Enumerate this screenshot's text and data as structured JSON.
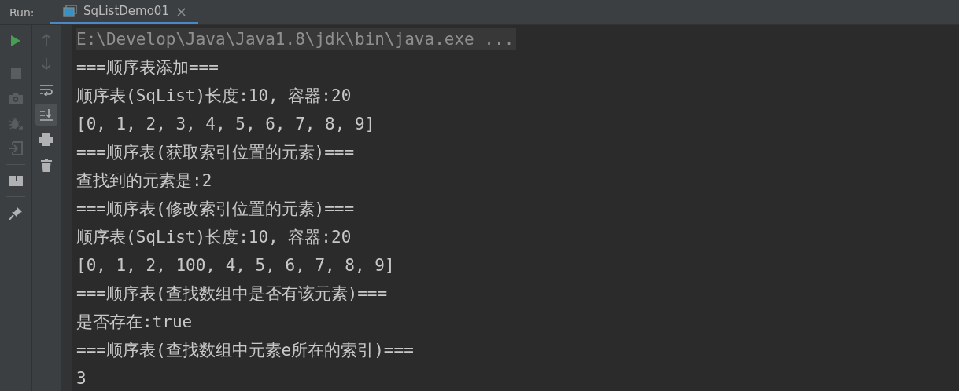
{
  "run_panel": {
    "label": "Run:",
    "tabs": [
      {
        "title": "SqListDemo01",
        "close": "×",
        "selected": true
      }
    ]
  },
  "left_toolbar": [
    [
      {
        "kind": "run",
        "disabled": false
      }
    ],
    [
      {
        "kind": "stop",
        "disabled": true
      },
      {
        "kind": "camera",
        "disabled": true
      },
      {
        "kind": "bug",
        "disabled": true
      },
      {
        "kind": "exit",
        "disabled": true
      }
    ],
    [
      {
        "kind": "layout",
        "disabled": false
      }
    ],
    [
      {
        "kind": "pin",
        "disabled": false
      }
    ]
  ],
  "console_toolbar": [
    {
      "kind": "up",
      "disabled": true,
      "on": false
    },
    {
      "kind": "down",
      "disabled": true,
      "on": false
    },
    {
      "kind": "wrap",
      "disabled": false,
      "on": false
    },
    {
      "kind": "scroll-end",
      "disabled": false,
      "on": true
    },
    {
      "kind": "print",
      "disabled": false,
      "on": false
    },
    {
      "kind": "trash",
      "disabled": false,
      "on": false
    }
  ],
  "console_lines": [
    {
      "kind": "command",
      "text": "E:\\Develop\\Java\\Java1.8\\jdk\\bin\\java.exe ..."
    },
    {
      "kind": "output",
      "text": "===顺序表添加==="
    },
    {
      "kind": "output",
      "text": "顺序表(SqList)长度:10, 容器:20"
    },
    {
      "kind": "output",
      "text": "[0, 1, 2, 3, 4, 5, 6, 7, 8, 9]"
    },
    {
      "kind": "output",
      "text": "===顺序表(获取索引位置的元素)==="
    },
    {
      "kind": "output",
      "text": "查找到的元素是:2"
    },
    {
      "kind": "output",
      "text": "===顺序表(修改索引位置的元素)==="
    },
    {
      "kind": "output",
      "text": "顺序表(SqList)长度:10, 容器:20"
    },
    {
      "kind": "output",
      "text": "[0, 1, 2, 100, 4, 5, 6, 7, 8, 9]"
    },
    {
      "kind": "output",
      "text": "===顺序表(查找数组中是否有该元素)==="
    },
    {
      "kind": "output",
      "text": "是否存在:true"
    },
    {
      "kind": "output",
      "text": "===顺序表(查找数组中元素e所在的索引)==="
    },
    {
      "kind": "output",
      "text": "3"
    }
  ]
}
